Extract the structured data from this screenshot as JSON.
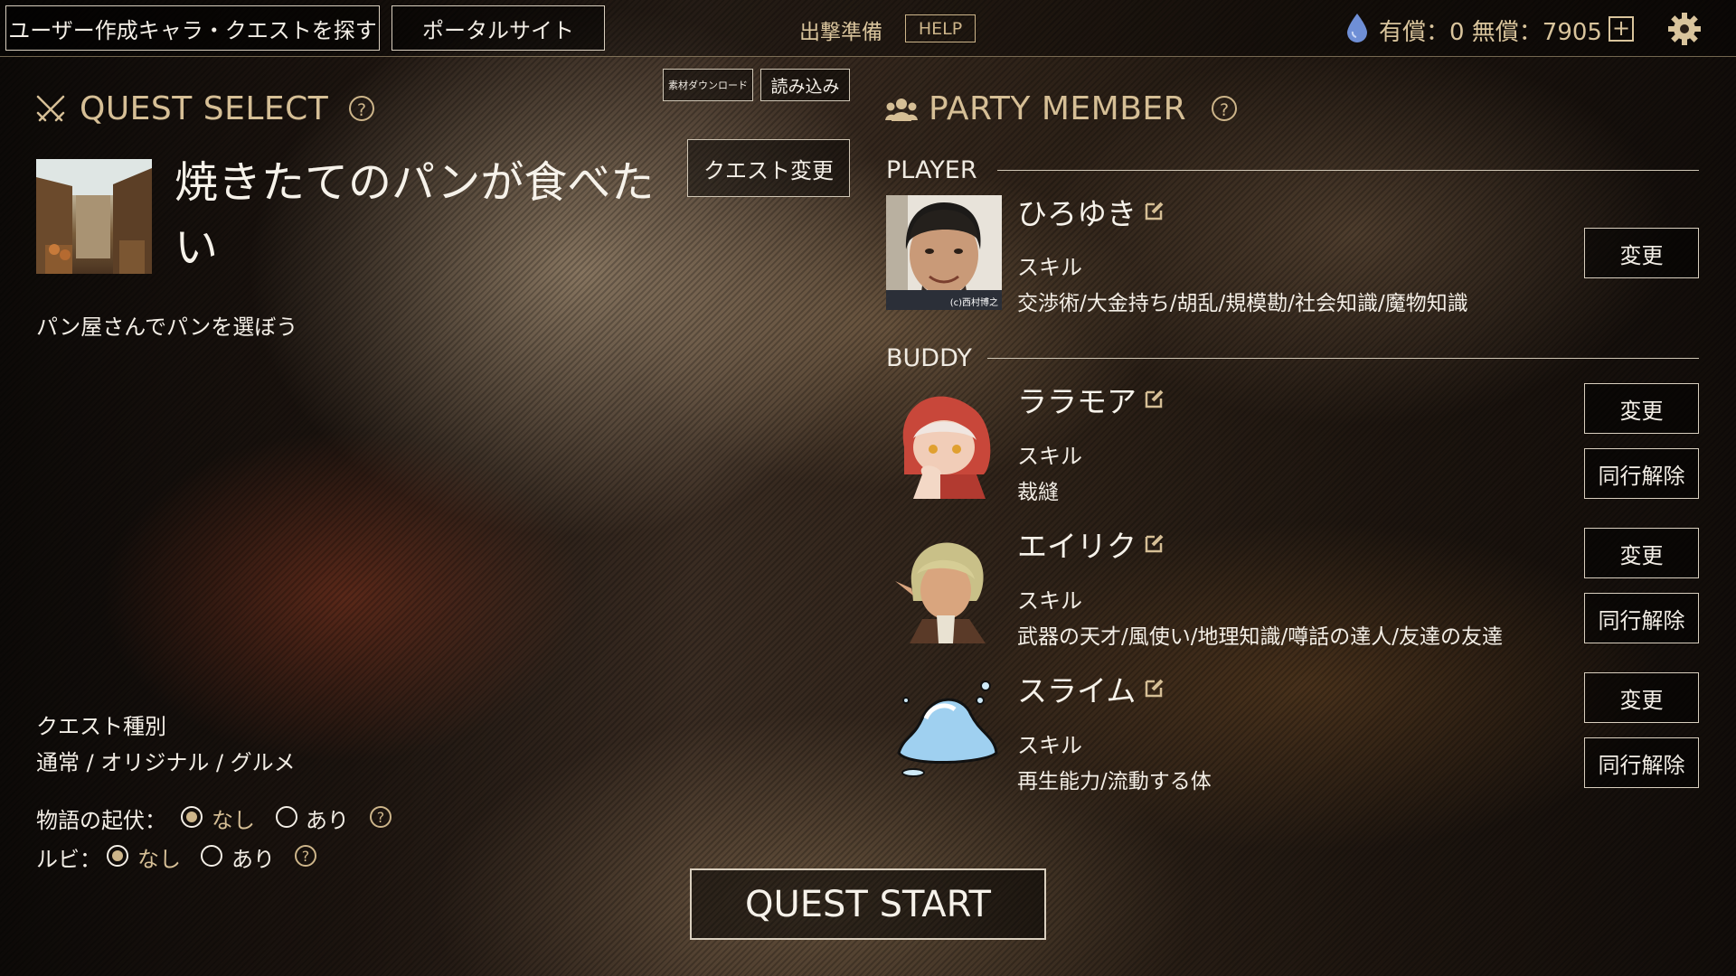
{
  "topbar": {
    "search_user_chars": "ユーザー作成キャラ・クエストを探す",
    "portal_site": "ポータルサイト",
    "sortie_prep": "出撃準備",
    "help": "HELP",
    "currency": "有償：0 無償：7905",
    "paid_label": "有償",
    "paid_value": 0,
    "free_label": "無償",
    "free_value": 7905
  },
  "quest": {
    "heading": "QUEST SELECT",
    "material_download": "素材ダウンロード",
    "load": "読み込み",
    "change_button": "クエスト変更",
    "title": "焼きたてのパンが食べたい",
    "description": "パン屋さんでパンを選ぼう",
    "type_label": "クエスト種別",
    "type_value": "通常 / オリジナル / グルメ",
    "story_label": "物語の起伏：",
    "ruby_label": "ルビ：",
    "option_none": "なし",
    "option_yes": "あり",
    "story_selected": "なし",
    "ruby_selected": "なし",
    "start_button": "QUEST START"
  },
  "party": {
    "heading": "PARTY MEMBER",
    "player_label": "PLAYER",
    "buddy_label": "BUDDY",
    "skill_label": "スキル",
    "change_label": "変更",
    "remove_label": "同行解除",
    "player": {
      "name": "ひろゆき",
      "skills": "交渉術/大金持ち/胡乱/規模勘/社会知識/魔物知識",
      "photo_credit": "(c)西村博之"
    },
    "buddies": [
      {
        "name": "ララモア",
        "skills": "裁縫"
      },
      {
        "name": "エイリク",
        "skills": "武器の天才/風使い/地理知識/噂話の達人/友達の友達"
      },
      {
        "name": "スライム",
        "skills": "再生能力/流動する体"
      }
    ]
  },
  "colors": {
    "gold": "#d6bf96",
    "text": "#f3eee6",
    "drop": "#6f8fd6"
  }
}
